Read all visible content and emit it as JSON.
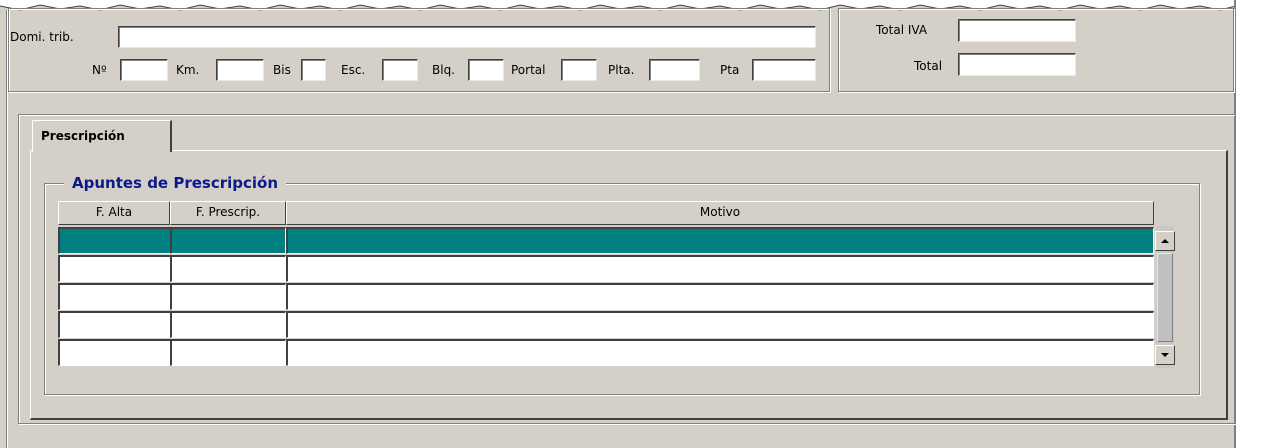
{
  "address": {
    "domicilio_label": "Domi. trib.",
    "domicilio_value": "",
    "numero_label": "Nº",
    "km_label": "Km.",
    "bis_label": "Bis",
    "esc_label": "Esc.",
    "blq_label": "Blq.",
    "portal_label": "Portal",
    "plta_label": "Plta.",
    "pta_label": "Pta"
  },
  "totals": {
    "total_iva_label": "Total IVA",
    "total_iva_value": "",
    "total_label": "Total",
    "total_value": ""
  },
  "tabs": [
    {
      "label": "Prescripción",
      "active": true
    }
  ],
  "group": {
    "title": "Apuntes de Prescripción"
  },
  "grid": {
    "columns": [
      "F. Alta",
      "F. Prescrip.",
      "Motivo"
    ],
    "rows": [
      [
        "",
        "",
        ""
      ],
      [
        "",
        "",
        ""
      ],
      [
        "",
        "",
        ""
      ],
      [
        "",
        "",
        ""
      ],
      [
        "",
        "",
        ""
      ]
    ],
    "selected_row": 0
  },
  "colors": {
    "selection": "#008080",
    "group_title": "#0a1a8a",
    "face": "#d4d0c8"
  },
  "icons": {
    "scroll_up": "scroll-up-arrow-icon",
    "scroll_down": "scroll-down-arrow-icon"
  }
}
